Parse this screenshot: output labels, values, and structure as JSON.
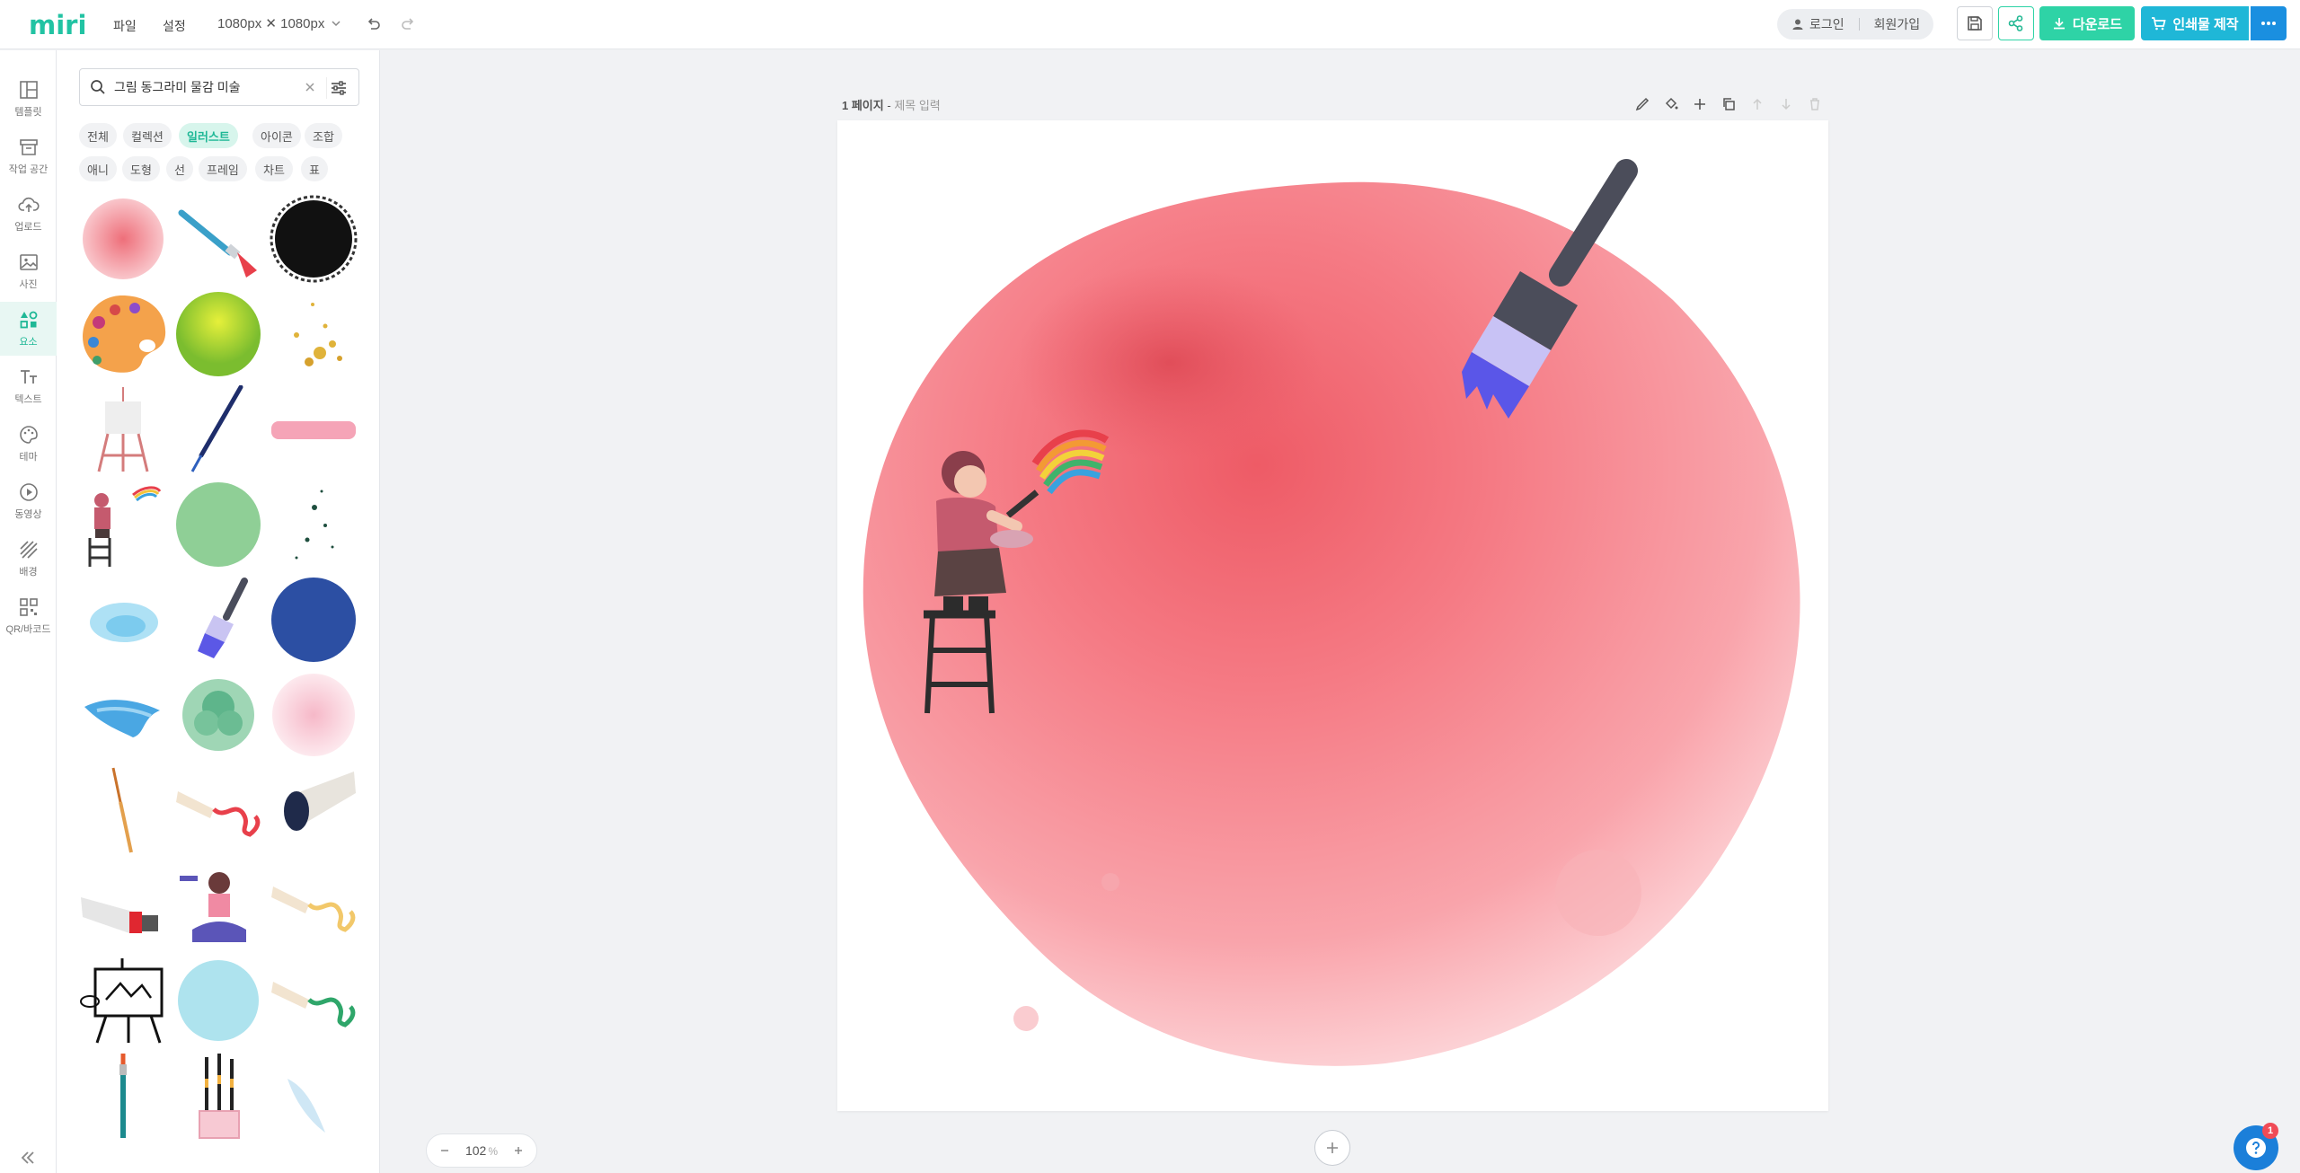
{
  "app": {
    "logo_text": "miri",
    "brand_color": "#22c3a3"
  },
  "topbar": {
    "menu": [
      {
        "label": "파일"
      },
      {
        "label": "설정"
      }
    ],
    "canvas_size": "1080px ✕ 1080px",
    "login_label": "로그인",
    "signup_label": "회원가입",
    "download_label": "다운로드",
    "print_label": "인쇄물 제작",
    "colors": {
      "download": "#2ed3a6",
      "print": "#1fb7d7",
      "more": "#1a8fe0"
    }
  },
  "rail": {
    "items": [
      {
        "label": "템플릿",
        "icon": "template-icon"
      },
      {
        "label": "작업 공간",
        "icon": "workspace-icon"
      },
      {
        "label": "업로드",
        "icon": "upload-icon"
      },
      {
        "label": "사진",
        "icon": "photo-icon"
      },
      {
        "label": "요소",
        "icon": "elements-icon",
        "active": true
      },
      {
        "label": "텍스트",
        "icon": "text-icon"
      },
      {
        "label": "테마",
        "icon": "theme-icon"
      },
      {
        "label": "동영상",
        "icon": "video-icon"
      },
      {
        "label": "배경",
        "icon": "background-icon"
      },
      {
        "label": "QR/바코드",
        "icon": "qr-icon"
      }
    ]
  },
  "panel": {
    "search": {
      "value": "그림 동그라미 물감 미술",
      "placeholder": ""
    },
    "chips_row1": [
      {
        "label": "전체"
      },
      {
        "label": "컬렉션"
      },
      {
        "label": "일러스트",
        "active": true
      },
      {
        "label": "아이콘"
      },
      {
        "label": "조합"
      }
    ],
    "chips_row2": [
      {
        "label": "애니"
      },
      {
        "label": "도형"
      },
      {
        "label": "선"
      },
      {
        "label": "프레임"
      },
      {
        "label": "차트"
      },
      {
        "label": "표"
      }
    ],
    "thumbnails": [
      "red-watercolor-circle",
      "paint-brush",
      "black-ink-circle",
      "paint-palette",
      "lime-watercolor-circle",
      "gold-splatter",
      "easel",
      "fine-brush",
      "pink-brush-stroke",
      "painter-on-ladder",
      "green-circle",
      "dot-splatter",
      "blue-watercolor-cloud",
      "flat-brush",
      "navy-circle",
      "blue-watercolor-splash",
      "green-watercolor-flower",
      "pink-watercolor-circle",
      "thin-brush",
      "red-paint-tube",
      "black-paint-tube",
      "red-tube",
      "girl-painting",
      "yellow-paint-tube",
      "drawing-board",
      "cyan-watercolor-circle",
      "green-paint-tube",
      "teal-brush",
      "brush-cup",
      "light-blue-splash"
    ]
  },
  "canvas": {
    "page_label": "1 페이지",
    "title_placeholder": "제목 입력",
    "zoom_value": "102",
    "zoom_unit": "%",
    "watercolor_color": "#f06a74"
  },
  "help": {
    "badge": "1"
  }
}
